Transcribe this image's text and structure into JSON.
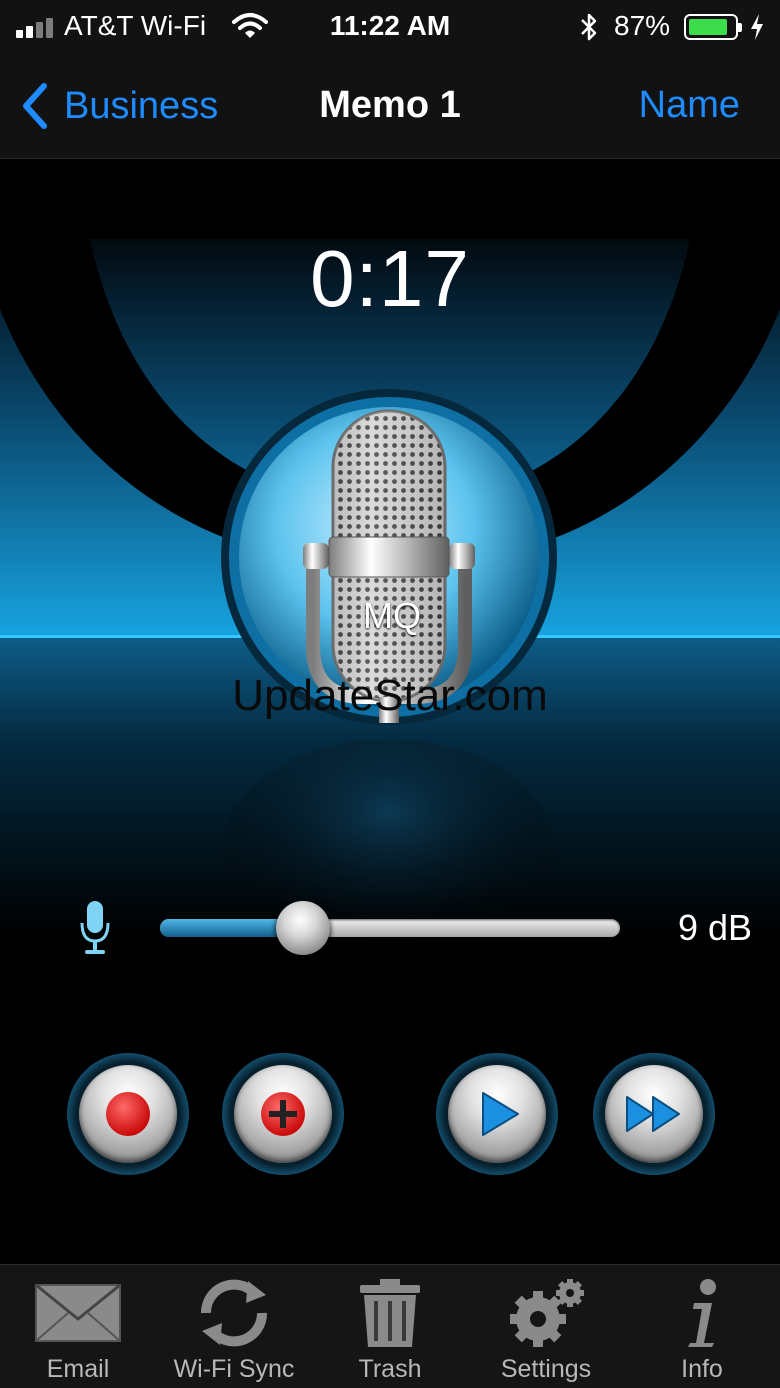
{
  "status_bar": {
    "carrier": "AT&T Wi-Fi",
    "time": "11:22 AM",
    "battery_percent": "87%",
    "battery_level": 0.87
  },
  "nav": {
    "back_label": "Business",
    "title": "Memo 1",
    "right_action": "Name"
  },
  "recorder": {
    "elapsed": "0:17",
    "logo_text": "MQ",
    "watermark": "UpdateStar.com"
  },
  "level": {
    "value_label": "9 dB",
    "fraction": 0.31
  },
  "controls": [
    {
      "name": "record-button",
      "icon": "record-dot-icon"
    },
    {
      "name": "append-record-button",
      "icon": "record-plus-icon"
    },
    {
      "name": "play-button",
      "icon": "play-icon"
    },
    {
      "name": "fast-forward-button",
      "icon": "fast-forward-icon"
    }
  ],
  "tabs": [
    {
      "label": "Email",
      "icon": "envelope-icon"
    },
    {
      "label": "Wi-Fi Sync",
      "icon": "sync-arrows-icon"
    },
    {
      "label": "Trash",
      "icon": "trash-can-icon"
    },
    {
      "label": "Settings",
      "icon": "gears-icon"
    },
    {
      "label": "Info",
      "icon": "info-icon"
    }
  ],
  "colors": {
    "accent_blue": "#1e8bff",
    "stage_blue": "#0e86c4",
    "record_red": "#e01818",
    "play_blue": "#1b8fe0",
    "battery_green": "#3ddc4a"
  }
}
